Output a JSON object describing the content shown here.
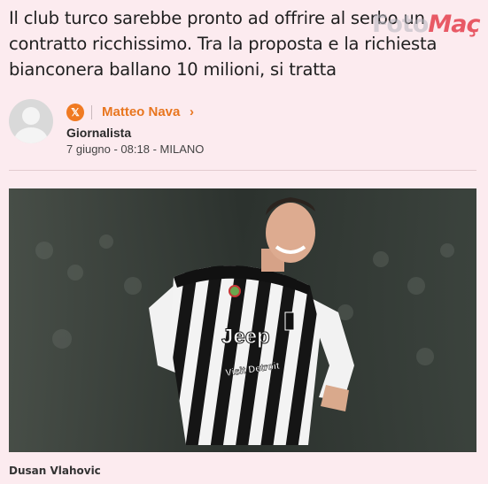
{
  "article": {
    "subtitle": "Il club turco sarebbe pronto ad offrire al serbo un contratto ricchissimo. Tra la proposta e la richiesta bianconera ballano 10 milioni, si tratta",
    "watermark_a": "Foto",
    "watermark_b": "Maç"
  },
  "author": {
    "social_icon": "x-icon",
    "name": "Matteo Nava",
    "chevron": "›",
    "role": "Giornalista",
    "dateline": "7 giugno - 08:18 - MILANO"
  },
  "photo": {
    "kit_sponsor": "Jeep",
    "kit_sleeve": "Visit Detroit",
    "caption": "Dusan Vlahovic"
  },
  "colors": {
    "background": "#fcebef",
    "accent": "#e8761f",
    "x_badge": "#f07a22"
  }
}
